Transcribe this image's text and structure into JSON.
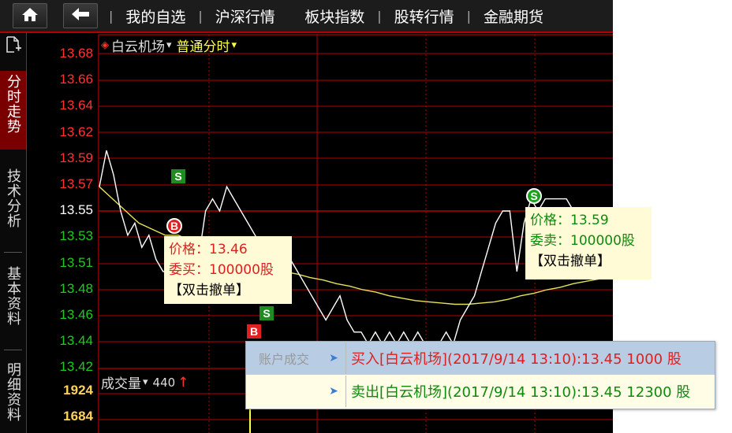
{
  "nav": {
    "home_icon": "home-icon",
    "back_icon": "back-arrow-icon",
    "items": [
      "我的自选",
      "沪深行情",
      "板块指数",
      "股转行情",
      "金融期货"
    ],
    "separators": [
      "|",
      "|",
      "|",
      "|"
    ]
  },
  "sidebar": {
    "tabs": [
      "分时走势",
      "技术分析",
      "基本资料",
      "明细资料"
    ],
    "active": "分时走势"
  },
  "chart": {
    "stock_name": "白云机场",
    "mode": "普通分时",
    "dropdown_glyph": "▾",
    "stock_icon": "diamond-icon",
    "price_labels": [
      "13.68",
      "13.66",
      "13.64",
      "13.62",
      "13.59",
      "13.57",
      "13.55",
      "13.53",
      "13.51",
      "13.48",
      "13.46",
      "13.44",
      "13.42"
    ],
    "volume_labels": [
      "1924",
      "1684"
    ],
    "volume_header": "成交量",
    "volume_value": "440",
    "volume_arrow": "↑"
  },
  "markers": [
    {
      "letter": "S",
      "style": "square"
    },
    {
      "letter": "B",
      "style": "circle"
    },
    {
      "letter": "S",
      "style": "square"
    },
    {
      "letter": "B",
      "style": "square"
    },
    {
      "letter": "S",
      "style": "circle"
    }
  ],
  "buy_order": {
    "price_label": "价格：13.46",
    "qty_label": "委买：100000股",
    "cancel_label": "【双击撤单】"
  },
  "sell_order": {
    "price_label": "价格：13.59",
    "qty_label": "委卖：100000股",
    "cancel_label": "【双击撤单】"
  },
  "trade_popup": {
    "title": "账户成交",
    "rows": [
      "买入[白云机场](2017/9/14 13:10):13.45  1000 股",
      "卖出[白云机场](2017/9/14 13:10):13.45  12300 股"
    ]
  },
  "colors": {
    "up": "#ff3232",
    "down": "#22c822",
    "flat": "#ffffff",
    "avg_line": "#e6e25a",
    "grid": "#b40000",
    "volume_label": "#ffd25a"
  },
  "chart_data": {
    "type": "line",
    "series": [
      {
        "values": [
          13.57,
          13.6,
          13.58,
          13.55,
          13.53,
          13.54,
          13.52,
          13.53,
          13.51,
          13.5,
          13.5,
          13.51,
          13.5,
          13.52,
          13.51,
          13.55,
          13.56,
          13.55,
          13.57,
          13.56,
          13.55,
          13.54,
          13.53,
          13.52,
          13.52,
          13.51,
          13.5,
          13.51,
          13.5,
          13.49,
          13.48,
          13.47,
          13.46,
          13.47,
          13.48,
          13.46,
          13.45,
          13.45,
          13.44,
          13.45,
          13.44,
          13.45,
          13.44,
          13.45,
          13.44,
          13.45,
          13.44,
          13.43,
          13.44,
          13.45,
          13.44,
          13.46,
          13.47,
          13.48,
          13.5,
          13.52,
          13.54,
          13.55,
          13.55,
          13.5,
          13.54,
          13.56,
          13.55,
          13.56,
          13.56,
          13.56,
          13.56,
          13.55,
          13.55,
          13.54
        ]
      },
      {
        "values": [
          13.57,
          13.56,
          13.55,
          13.54,
          13.535,
          13.53,
          13.53,
          13.525,
          13.525,
          13.52,
          13.52,
          13.515,
          13.51,
          13.505,
          13.5,
          13.498,
          13.495,
          13.493,
          13.49,
          13.488,
          13.485,
          13.483,
          13.48,
          13.478,
          13.476,
          13.475,
          13.474,
          13.473,
          13.473,
          13.474,
          13.475,
          13.477,
          13.48,
          13.482,
          13.485,
          13.487,
          13.49,
          13.492,
          13.494,
          13.495
        ]
      }
    ],
    "ylim": [
      13.41,
      13.69
    ]
  }
}
